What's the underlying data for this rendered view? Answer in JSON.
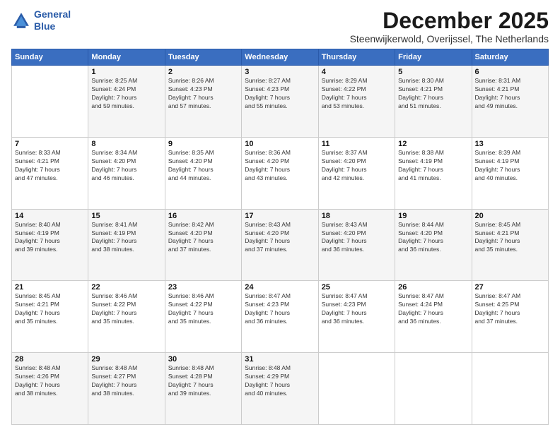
{
  "logo": {
    "line1": "General",
    "line2": "Blue"
  },
  "title": "December 2025",
  "location": "Steenwijkerwold, Overijssel, The Netherlands",
  "days_header": [
    "Sunday",
    "Monday",
    "Tuesday",
    "Wednesday",
    "Thursday",
    "Friday",
    "Saturday"
  ],
  "weeks": [
    [
      {
        "day": "",
        "info": ""
      },
      {
        "day": "1",
        "info": "Sunrise: 8:25 AM\nSunset: 4:24 PM\nDaylight: 7 hours\nand 59 minutes."
      },
      {
        "day": "2",
        "info": "Sunrise: 8:26 AM\nSunset: 4:23 PM\nDaylight: 7 hours\nand 57 minutes."
      },
      {
        "day": "3",
        "info": "Sunrise: 8:27 AM\nSunset: 4:23 PM\nDaylight: 7 hours\nand 55 minutes."
      },
      {
        "day": "4",
        "info": "Sunrise: 8:29 AM\nSunset: 4:22 PM\nDaylight: 7 hours\nand 53 minutes."
      },
      {
        "day": "5",
        "info": "Sunrise: 8:30 AM\nSunset: 4:21 PM\nDaylight: 7 hours\nand 51 minutes."
      },
      {
        "day": "6",
        "info": "Sunrise: 8:31 AM\nSunset: 4:21 PM\nDaylight: 7 hours\nand 49 minutes."
      }
    ],
    [
      {
        "day": "7",
        "info": "Sunrise: 8:33 AM\nSunset: 4:21 PM\nDaylight: 7 hours\nand 47 minutes."
      },
      {
        "day": "8",
        "info": "Sunrise: 8:34 AM\nSunset: 4:20 PM\nDaylight: 7 hours\nand 46 minutes."
      },
      {
        "day": "9",
        "info": "Sunrise: 8:35 AM\nSunset: 4:20 PM\nDaylight: 7 hours\nand 44 minutes."
      },
      {
        "day": "10",
        "info": "Sunrise: 8:36 AM\nSunset: 4:20 PM\nDaylight: 7 hours\nand 43 minutes."
      },
      {
        "day": "11",
        "info": "Sunrise: 8:37 AM\nSunset: 4:20 PM\nDaylight: 7 hours\nand 42 minutes."
      },
      {
        "day": "12",
        "info": "Sunrise: 8:38 AM\nSunset: 4:19 PM\nDaylight: 7 hours\nand 41 minutes."
      },
      {
        "day": "13",
        "info": "Sunrise: 8:39 AM\nSunset: 4:19 PM\nDaylight: 7 hours\nand 40 minutes."
      }
    ],
    [
      {
        "day": "14",
        "info": "Sunrise: 8:40 AM\nSunset: 4:19 PM\nDaylight: 7 hours\nand 39 minutes."
      },
      {
        "day": "15",
        "info": "Sunrise: 8:41 AM\nSunset: 4:19 PM\nDaylight: 7 hours\nand 38 minutes."
      },
      {
        "day": "16",
        "info": "Sunrise: 8:42 AM\nSunset: 4:20 PM\nDaylight: 7 hours\nand 37 minutes."
      },
      {
        "day": "17",
        "info": "Sunrise: 8:43 AM\nSunset: 4:20 PM\nDaylight: 7 hours\nand 37 minutes."
      },
      {
        "day": "18",
        "info": "Sunrise: 8:43 AM\nSunset: 4:20 PM\nDaylight: 7 hours\nand 36 minutes."
      },
      {
        "day": "19",
        "info": "Sunrise: 8:44 AM\nSunset: 4:20 PM\nDaylight: 7 hours\nand 36 minutes."
      },
      {
        "day": "20",
        "info": "Sunrise: 8:45 AM\nSunset: 4:21 PM\nDaylight: 7 hours\nand 35 minutes."
      }
    ],
    [
      {
        "day": "21",
        "info": "Sunrise: 8:45 AM\nSunset: 4:21 PM\nDaylight: 7 hours\nand 35 minutes."
      },
      {
        "day": "22",
        "info": "Sunrise: 8:46 AM\nSunset: 4:22 PM\nDaylight: 7 hours\nand 35 minutes."
      },
      {
        "day": "23",
        "info": "Sunrise: 8:46 AM\nSunset: 4:22 PM\nDaylight: 7 hours\nand 35 minutes."
      },
      {
        "day": "24",
        "info": "Sunrise: 8:47 AM\nSunset: 4:23 PM\nDaylight: 7 hours\nand 36 minutes."
      },
      {
        "day": "25",
        "info": "Sunrise: 8:47 AM\nSunset: 4:23 PM\nDaylight: 7 hours\nand 36 minutes."
      },
      {
        "day": "26",
        "info": "Sunrise: 8:47 AM\nSunset: 4:24 PM\nDaylight: 7 hours\nand 36 minutes."
      },
      {
        "day": "27",
        "info": "Sunrise: 8:47 AM\nSunset: 4:25 PM\nDaylight: 7 hours\nand 37 minutes."
      }
    ],
    [
      {
        "day": "28",
        "info": "Sunrise: 8:48 AM\nSunset: 4:26 PM\nDaylight: 7 hours\nand 38 minutes."
      },
      {
        "day": "29",
        "info": "Sunrise: 8:48 AM\nSunset: 4:27 PM\nDaylight: 7 hours\nand 38 minutes."
      },
      {
        "day": "30",
        "info": "Sunrise: 8:48 AM\nSunset: 4:28 PM\nDaylight: 7 hours\nand 39 minutes."
      },
      {
        "day": "31",
        "info": "Sunrise: 8:48 AM\nSunset: 4:29 PM\nDaylight: 7 hours\nand 40 minutes."
      },
      {
        "day": "",
        "info": ""
      },
      {
        "day": "",
        "info": ""
      },
      {
        "day": "",
        "info": ""
      }
    ]
  ]
}
